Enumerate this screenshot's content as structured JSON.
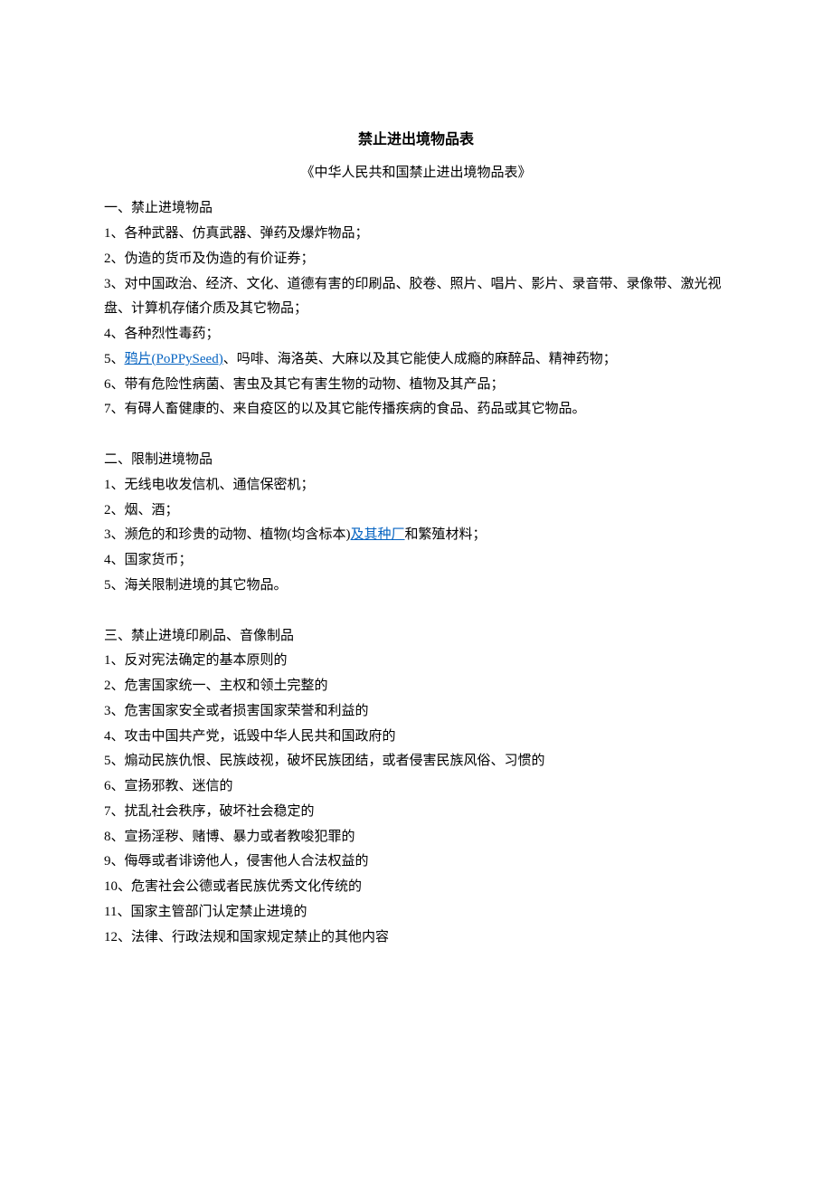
{
  "title": "禁止进出境物品表",
  "subtitle": "《中华人民共和国禁止进出境物品表》",
  "section1": {
    "header": "一、禁止进境物品",
    "items": {
      "i1": "1、各种武器、仿真武器、弹药及爆炸物品；",
      "i2": "2、伪造的货币及伪造的有价证券；",
      "i3": "3、对中国政治、经济、文化、道德有害的印刷品、胶卷、照片、唱片、影片、录音带、录像带、激光视盘、计算机存储介质及其它物品；",
      "i4": "4、各种烈性毒药；",
      "i5_num": "5、",
      "i5_link": "鸦片(PoPPySeed)",
      "i5_rest": "、吗啡、海洛英、大麻以及其它能使人成瘾的麻醉品、精神药物；",
      "i6": "6、带有危险性病菌、害虫及其它有害生物的动物、植物及其产品；",
      "i7": "7、有碍人畜健康的、来自疫区的以及其它能传播疾病的食品、药品或其它物品。"
    }
  },
  "section2": {
    "header": "二、限制进境物品",
    "items": {
      "i1": "1、无线电收发信机、通信保密机；",
      "i2": "2、烟、酒；",
      "i3_pre": "3、濒危的和珍贵的动物、植物(均含标本)",
      "i3_link": "及其种厂",
      "i3_rest": "和繁殖材料；",
      "i4": "4、国家货币；",
      "i5": "5、海关限制进境的其它物品。"
    }
  },
  "section3": {
    "header": "三、禁止进境印刷品、音像制品",
    "items": {
      "i1": "1、反对宪法确定的基本原则的",
      "i2": "2、危害国家统一、主权和领土完整的",
      "i3": "3、危害国家安全或者损害国家荣誉和利益的",
      "i4": "4、攻击中国共产党，诋毁中华人民共和国政府的",
      "i5": "5、煽动民族仇恨、民族歧视，破坏民族团结，或者侵害民族风俗、习惯的",
      "i6": "6、宣扬邪教、迷信的",
      "i7": "7、扰乱社会秩序，破坏社会稳定的",
      "i8": "8、宣扬淫秽、赌博、暴力或者教唆犯罪的",
      "i9": "9、侮辱或者诽谤他人，侵害他人合法权益的",
      "i10": "10、危害社会公德或者民族优秀文化传统的",
      "i11": "11、国家主管部门认定禁止进境的",
      "i12": "12、法律、行政法规和国家规定禁止的其他内容"
    }
  }
}
